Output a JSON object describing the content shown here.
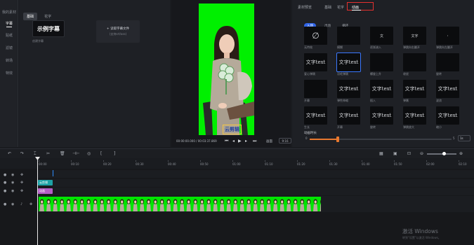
{
  "leftnav": {
    "items": [
      {
        "label": "我的素材",
        "active": false
      },
      {
        "label": "字幕",
        "active": true
      },
      {
        "label": "贴纸",
        "active": false
      },
      {
        "label": "滤镜",
        "active": false
      },
      {
        "label": "转场",
        "active": false
      },
      {
        "label": "特效",
        "active": false
      }
    ]
  },
  "asset_panel": {
    "tabs": [
      "基础",
      "花字"
    ],
    "active_tab": "基础",
    "sample_card_text": "示例字幕",
    "sample_card_caption": "创建字幕",
    "upload_line1": "+ 读取字幕文件",
    "upload_line2": "(支持srt/ass)"
  },
  "preview": {
    "caption_text": "云剪辑",
    "time_text": "00:00:00.000 / 00:03:37.869",
    "cover_label": "画面",
    "ratio_label": "9:16"
  },
  "right_panel": {
    "tabs": [
      "素材预览",
      "基础",
      "花字",
      "动画"
    ],
    "active_tab": "动画",
    "subtabs": [
      "入场",
      "出场",
      "循环"
    ],
    "active_subtab": "入场",
    "effects": [
      {
        "name": "无特效",
        "preview": "∅",
        "kind": "none"
      },
      {
        "name": "模糊",
        "preview": "",
        "kind": "blank"
      },
      {
        "name": "逐渐溶入",
        "preview": "文",
        "kind": "small"
      },
      {
        "name": "弹跳向右翻开",
        "preview": "文字",
        "kind": "tiny"
      },
      {
        "name": "弹跳向左翻开",
        "preview": ":",
        "kind": "tiny"
      },
      {
        "name": "爱心弹跳",
        "preview": "文字text",
        "kind": "text"
      },
      {
        "name": "羽毛弹跳",
        "preview": "文字text",
        "kind": "text",
        "selected": true
      },
      {
        "name": "螺旋上升",
        "preview": "",
        "kind": "blank"
      },
      {
        "name": "收拢",
        "preview": "",
        "kind": "blank"
      },
      {
        "name": "旋转",
        "preview": "",
        "kind": "blank"
      },
      {
        "name": "开幕",
        "preview": "",
        "kind": "blank"
      },
      {
        "name": "弹性伸缩",
        "preview": "文字text",
        "kind": "text"
      },
      {
        "name": "插入",
        "preview": "文字text",
        "kind": "text"
      },
      {
        "name": "弹簧",
        "preview": "文字text",
        "kind": "text"
      },
      {
        "name": "波浪",
        "preview": "文字text",
        "kind": "text"
      },
      {
        "name": "生长",
        "preview": "文字text",
        "kind": "text"
      },
      {
        "name": "开幕",
        "preview": "文字text",
        "kind": "text"
      },
      {
        "name": "旋转",
        "preview": "文字text",
        "kind": "text"
      },
      {
        "name": "弹跳放大",
        "preview": "文字text",
        "kind": "text"
      },
      {
        "name": "缩小",
        "preview": "文字text",
        "kind": "text"
      }
    ],
    "duration_label": "动画时长",
    "slider_min": "0",
    "slider_max": "5",
    "slider_value_fraction": 0.2,
    "duration_value": "1s"
  },
  "timeline": {
    "ticks": [
      "00:00",
      "00:10",
      "00:20",
      "00:30",
      "00:40",
      "00:50",
      "01:00",
      "01:10",
      "01:20",
      "01:30",
      "01:40",
      "01:50",
      "02:00",
      "02:10"
    ],
    "text_clip_label": "云剪辑",
    "anim_clip_label": "动画"
  },
  "watermark": {
    "line1": "激活 Windows",
    "line2": "转到\"设置\"以激活 Windows。"
  },
  "colors": {
    "accent_blue": "#3165e6",
    "highlight_red": "#e5302f",
    "slider_orange": "#e8782f",
    "green_screen": "#00f000",
    "text_clip": "#1ea2a6",
    "anim_clip": "#b45fc5"
  }
}
